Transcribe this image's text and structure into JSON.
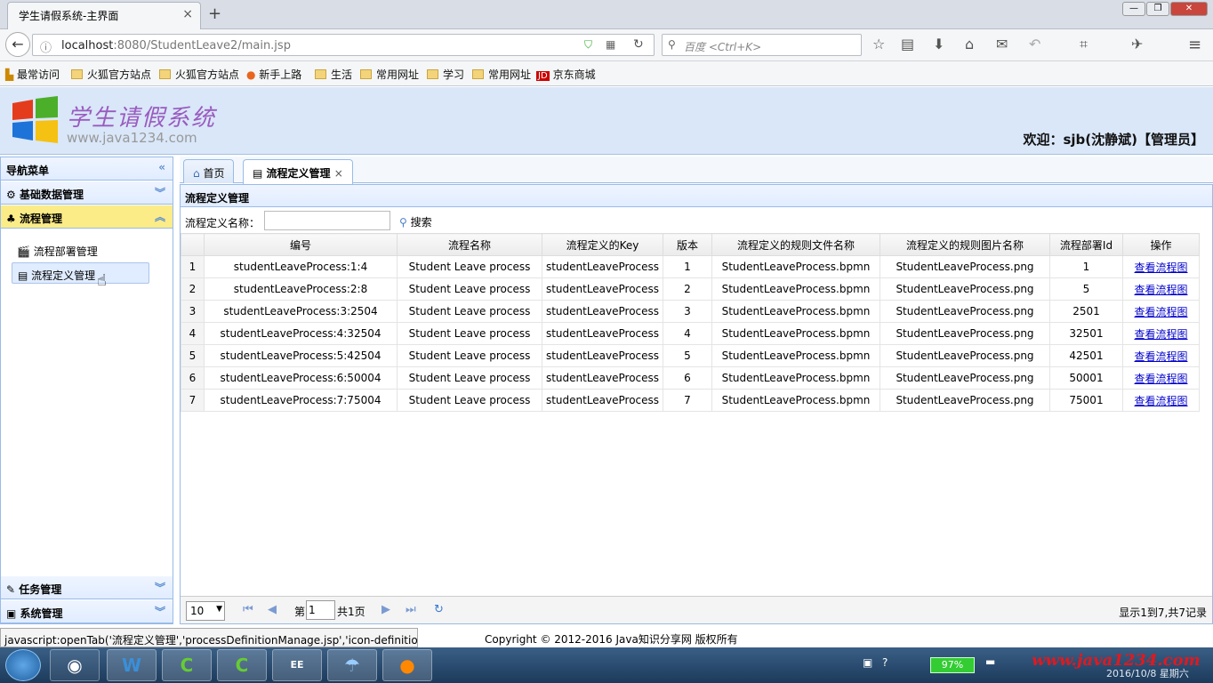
{
  "browser": {
    "tab_title": "学生请假系统-主界面",
    "tab_close": "×",
    "new_tab": "+",
    "url_host": "localhost",
    "url_path": ":8080/StudentLeave2/main.jsp",
    "search_placeholder": "百度 <Ctrl+K>"
  },
  "bookmarks": [
    "最常访问",
    "火狐官方站点",
    "火狐官方站点",
    "新手上路",
    "生活",
    "常用网址",
    "学习",
    "常用网址",
    "京东商城"
  ],
  "header": {
    "title": "学生请假系统",
    "subtitle": "www.java1234.com",
    "welcome": "欢迎：sjb(沈静斌)【管理员】"
  },
  "sidebar": {
    "title": "导航菜单",
    "sections": [
      {
        "label": "基础数据管理"
      },
      {
        "label": "流程管理",
        "items": [
          "流程部署管理",
          "流程定义管理"
        ]
      },
      {
        "label": "任务管理"
      },
      {
        "label": "系统管理"
      }
    ]
  },
  "tabs": {
    "home": "首页",
    "current": "流程定义管理",
    "close": "×"
  },
  "panel": {
    "title": "流程定义管理",
    "filter_label": "流程定义名称：",
    "search_button": "搜索"
  },
  "table": {
    "columns": [
      "编号",
      "流程名称",
      "流程定义的Key",
      "版本",
      "流程定义的规则文件名称",
      "流程定义的规则图片名称",
      "流程部署Id",
      "操作"
    ],
    "rows": [
      [
        "1",
        "studentLeaveProcess:1:4",
        "Student Leave process",
        "studentLeaveProcess",
        "1",
        "StudentLeaveProcess.bpmn",
        "StudentLeaveProcess.png",
        "1",
        "查看流程图"
      ],
      [
        "2",
        "studentLeaveProcess:2:8",
        "Student Leave process",
        "studentLeaveProcess",
        "2",
        "StudentLeaveProcess.bpmn",
        "StudentLeaveProcess.png",
        "5",
        "查看流程图"
      ],
      [
        "3",
        "studentLeaveProcess:3:2504",
        "Student Leave process",
        "studentLeaveProcess",
        "3",
        "StudentLeaveProcess.bpmn",
        "StudentLeaveProcess.png",
        "2501",
        "查看流程图"
      ],
      [
        "4",
        "studentLeaveProcess:4:32504",
        "Student Leave process",
        "studentLeaveProcess",
        "4",
        "StudentLeaveProcess.bpmn",
        "StudentLeaveProcess.png",
        "32501",
        "查看流程图"
      ],
      [
        "5",
        "studentLeaveProcess:5:42504",
        "Student Leave process",
        "studentLeaveProcess",
        "5",
        "StudentLeaveProcess.bpmn",
        "StudentLeaveProcess.png",
        "42501",
        "查看流程图"
      ],
      [
        "6",
        "studentLeaveProcess:6:50004",
        "Student Leave process",
        "studentLeaveProcess",
        "6",
        "StudentLeaveProcess.bpmn",
        "StudentLeaveProcess.png",
        "50001",
        "查看流程图"
      ],
      [
        "7",
        "studentLeaveProcess:7:75004",
        "Student Leave process",
        "studentLeaveProcess",
        "7",
        "StudentLeaveProcess.bpmn",
        "StudentLeaveProcess.png",
        "75001",
        "查看流程图"
      ]
    ]
  },
  "pager": {
    "page_size": "10",
    "page_prefix": "第",
    "page_value": "1",
    "page_total": "共1页",
    "info": "显示1到7,共7记录"
  },
  "status_text": "javascript:openTab('流程定义管理','processDefinitionManage.jsp','icon-definition')",
  "copyright": "Copyright © 2012-2016 Java知识分享网 版权所有",
  "taskbar": {
    "battery": "97%",
    "watermark": "www.java1234.com",
    "date": "2016/10/8 星期六"
  }
}
